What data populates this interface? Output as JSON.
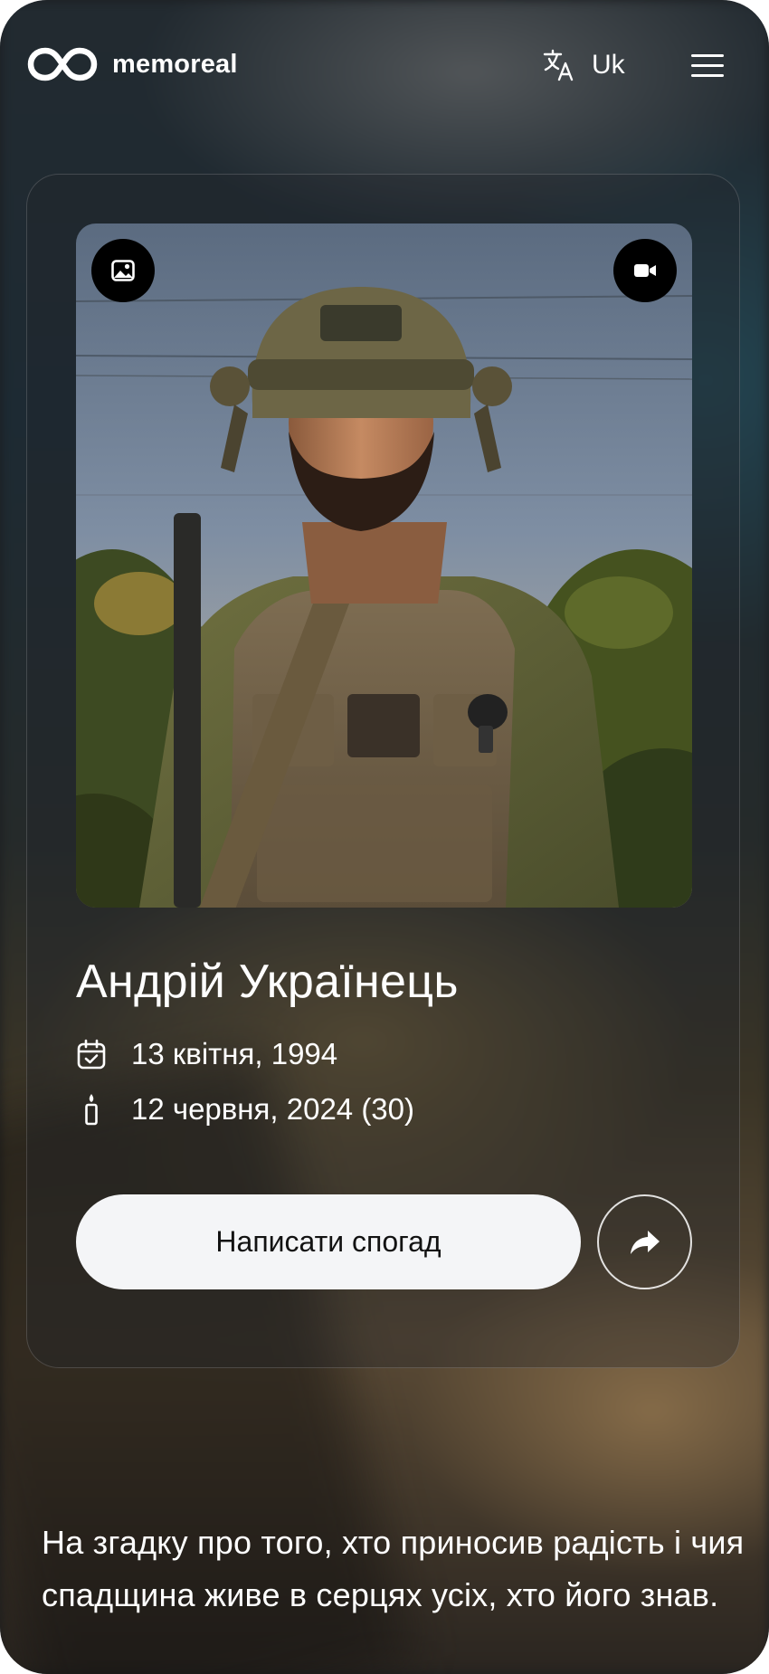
{
  "header": {
    "logo_text": "memoreal",
    "language_label": "Uk"
  },
  "profile": {
    "name": "Андрій Українець",
    "birth_date": "13 квітня, 1994",
    "death_date": "12 червня, 2024 (30)"
  },
  "actions": {
    "write_memory_label": "Написати спогад"
  },
  "tagline": "На згадку про того, хто приносив радість і чия спадщина живе в серцях усіх, хто його знав.",
  "icons": {
    "logo": "infinity-icon",
    "language": "translate-icon",
    "menu": "hamburger-menu-icon",
    "gallery": "image-icon",
    "video": "video-camera-icon",
    "birth": "calendar-check-icon",
    "death": "candle-icon",
    "share": "share-arrow-icon"
  },
  "colors": {
    "button_bg": "#f4f5f7",
    "button_text": "#121212",
    "text": "#ffffff"
  }
}
